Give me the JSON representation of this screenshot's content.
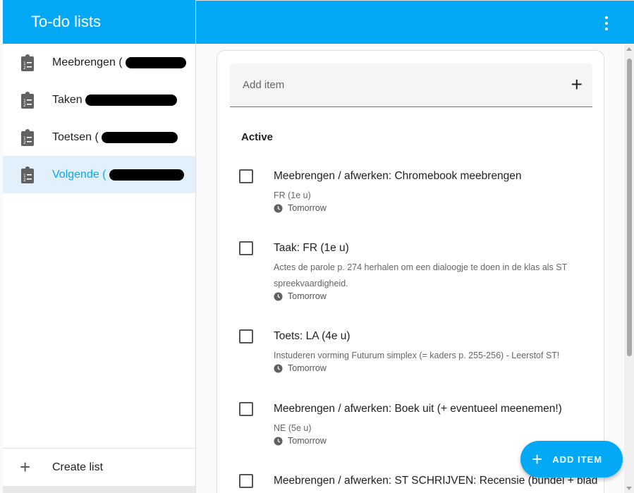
{
  "sidebar": {
    "title": "To-do lists",
    "lists": [
      {
        "label": "Meebrengen (",
        "selected": false
      },
      {
        "label": "Taken",
        "selected": false
      },
      {
        "label": "Toetsen (",
        "selected": false
      },
      {
        "label": "Volgende (",
        "selected": true
      }
    ],
    "create_label": "Create list"
  },
  "main": {
    "add_placeholder": "Add item",
    "section_title": "Active",
    "items": [
      {
        "title": "Meebrengen / afwerken: Chromebook meebrengen",
        "desc": [
          "FR (1e u)"
        ],
        "due": "Tomorrow"
      },
      {
        "title": "Taak: FR (1e u)",
        "desc": [
          "Actes de parole p. 274 herhalen om een dialoogje te doen in de klas als ST",
          "spreekvaardigheid."
        ],
        "due": "Tomorrow"
      },
      {
        "title": "Toets: LA (4e u)",
        "desc": [
          "Instuderen vorming Futurum simplex (= kaders p. 255-256) - Leerstof ST!"
        ],
        "due": "Tomorrow"
      },
      {
        "title": "Meebrengen / afwerken: Boek uit (+ eventueel meenemen!)",
        "desc": [
          "NE (5e u)"
        ],
        "due": "Tomorrow"
      },
      {
        "title": "Meebrengen / afwerken: ST SCHRIJVEN: Recensie (bundel + blad",
        "desc": [],
        "due": ""
      }
    ]
  },
  "fab": {
    "label": "ADD ITEM"
  },
  "colors": {
    "accent": "#03a9f4",
    "selected_bg": "#e1f0fa"
  }
}
